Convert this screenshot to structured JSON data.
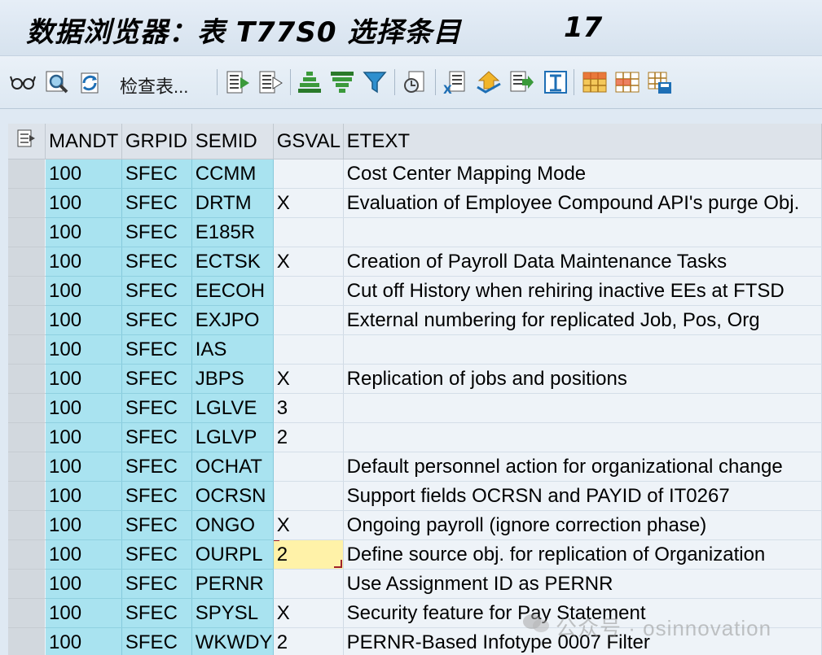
{
  "window": {
    "title": "数据浏览器：表 T77S0 选择条目",
    "entry_count": "17"
  },
  "toolbar": {
    "check_table_label": "检查表..."
  },
  "grid": {
    "columns": [
      "MANDT",
      "GRPID",
      "SEMID",
      "GSVAL",
      "ETEXT"
    ],
    "rows": [
      {
        "mandt": "100",
        "grpid": "SFEC",
        "semid": "CCMM",
        "gsval": "",
        "etext": "Cost Center Mapping Mode"
      },
      {
        "mandt": "100",
        "grpid": "SFEC",
        "semid": "DRTM",
        "gsval": "X",
        "etext": "Evaluation of Employee Compound API's purge Obj."
      },
      {
        "mandt": "100",
        "grpid": "SFEC",
        "semid": "E185R",
        "gsval": "",
        "etext": ""
      },
      {
        "mandt": "100",
        "grpid": "SFEC",
        "semid": "ECTSK",
        "gsval": "X",
        "etext": "Creation of Payroll Data Maintenance Tasks"
      },
      {
        "mandt": "100",
        "grpid": "SFEC",
        "semid": "EECOH",
        "gsval": "",
        "etext": "Cut off History when rehiring inactive EEs at FTSD"
      },
      {
        "mandt": "100",
        "grpid": "SFEC",
        "semid": "EXJPO",
        "gsval": "",
        "etext": "External numbering for replicated Job, Pos, Org"
      },
      {
        "mandt": "100",
        "grpid": "SFEC",
        "semid": "IAS",
        "gsval": "",
        "etext": ""
      },
      {
        "mandt": "100",
        "grpid": "SFEC",
        "semid": "JBPS",
        "gsval": "X",
        "etext": "Replication of jobs and positions"
      },
      {
        "mandt": "100",
        "grpid": "SFEC",
        "semid": "LGLVE",
        "gsval": "3",
        "etext": ""
      },
      {
        "mandt": "100",
        "grpid": "SFEC",
        "semid": "LGLVP",
        "gsval": "2",
        "etext": ""
      },
      {
        "mandt": "100",
        "grpid": "SFEC",
        "semid": "OCHAT",
        "gsval": "",
        "etext": "Default personnel action for organizational change"
      },
      {
        "mandt": "100",
        "grpid": "SFEC",
        "semid": "OCRSN",
        "gsval": "",
        "etext": "Support fields OCRSN and PAYID of IT0267"
      },
      {
        "mandt": "100",
        "grpid": "SFEC",
        "semid": "ONGO",
        "gsval": "X",
        "etext": "Ongoing payroll (ignore correction phase)"
      },
      {
        "mandt": "100",
        "grpid": "SFEC",
        "semid": "OURPL",
        "gsval": "2",
        "etext": "Define source obj. for replication of Organization",
        "current": true
      },
      {
        "mandt": "100",
        "grpid": "SFEC",
        "semid": "PERNR",
        "gsval": "",
        "etext": "Use Assignment ID as PERNR"
      },
      {
        "mandt": "100",
        "grpid": "SFEC",
        "semid": "SPYSL",
        "gsval": "X",
        "etext": "Security feature for Pay Statement"
      },
      {
        "mandt": "100",
        "grpid": "SFEC",
        "semid": "WKWDY",
        "gsval": "2",
        "etext": "PERNR-Based Infotype 0007 Filter"
      }
    ]
  },
  "watermark": {
    "text": "公众号 · osinnovation"
  },
  "colors": {
    "key_cell": "#a9e3f0",
    "data_cell": "#eef3f8",
    "current_cell": "#fff2a8",
    "header": "#dde3ea"
  },
  "icons": [
    "glasses-icon",
    "find-icon",
    "refresh-icon",
    "details-icon",
    "choose-icon",
    "sort-ascending-icon",
    "sort-descending-icon",
    "filter-icon",
    "total-icon",
    "export-icon",
    "send-icon",
    "print-preview-icon",
    "print-icon",
    "layout-icon",
    "select-layout-icon",
    "save-layout-icon"
  ]
}
